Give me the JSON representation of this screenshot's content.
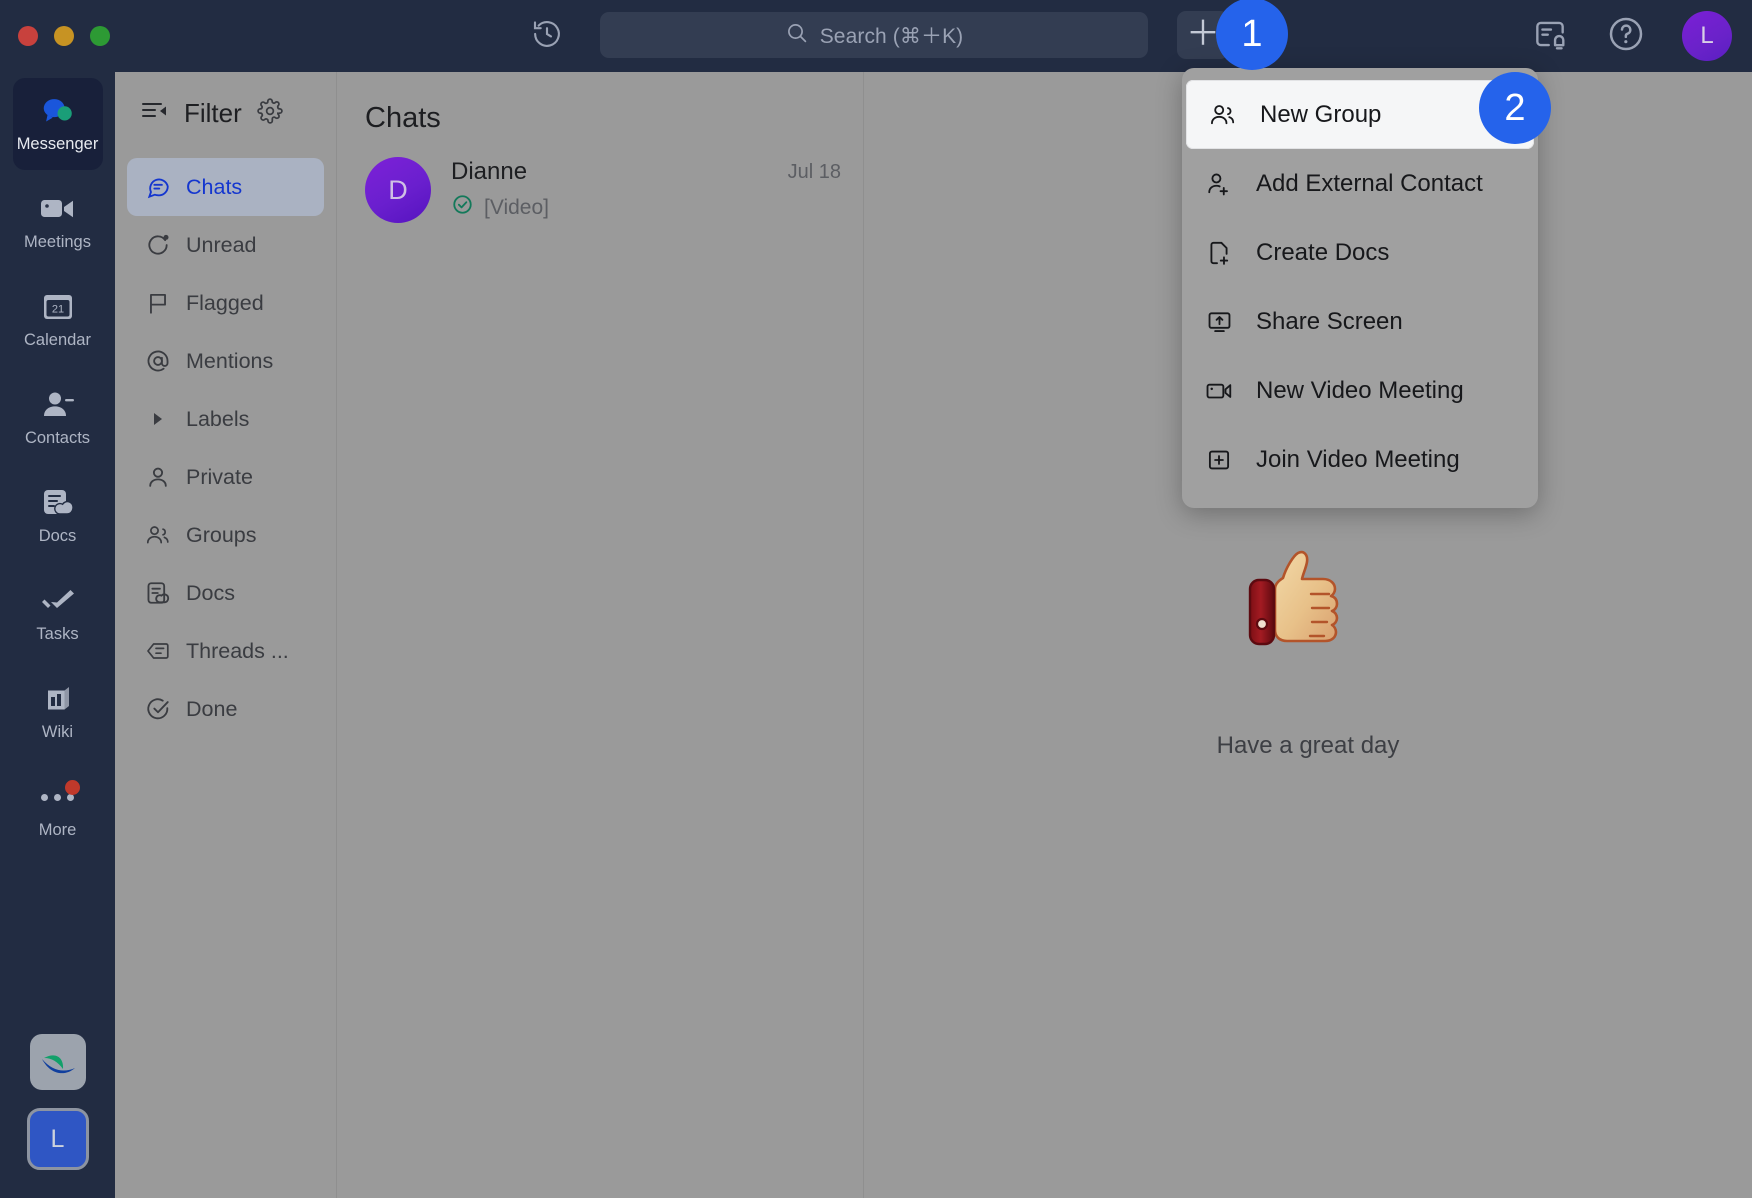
{
  "window": {
    "traffic_lights": [
      "close",
      "minimize",
      "zoom"
    ]
  },
  "topbar": {
    "history_icon": "history-clock-icon",
    "search": {
      "placeholder": "Search (⌘＋K)",
      "value": "",
      "icon": "search-icon"
    },
    "plus_label": "＋",
    "notifications_icon": "notifications-bell-icon",
    "help_icon": "help-circle-icon",
    "avatar_initial": "L"
  },
  "rail": {
    "items": [
      {
        "label": "Messenger",
        "icon": "messenger-bubbles-icon",
        "active": true
      },
      {
        "label": "Meetings",
        "icon": "video-camera-icon",
        "active": false
      },
      {
        "label": "Calendar",
        "icon": "calendar-21-icon",
        "active": false,
        "day": "21"
      },
      {
        "label": "Contacts",
        "icon": "contacts-person-icon",
        "active": false
      },
      {
        "label": "Docs",
        "icon": "docs-cloud-icon",
        "active": false
      },
      {
        "label": "Tasks",
        "icon": "tasks-check-icon",
        "active": false
      },
      {
        "label": "Wiki",
        "icon": "wiki-book-icon",
        "active": false
      },
      {
        "label": "More",
        "icon": "more-dots-icon",
        "active": false,
        "has_badge": true
      }
    ],
    "brand_icon": "app-brand-logo",
    "user_initial": "L"
  },
  "filter": {
    "title": "Filter",
    "settings_icon": "gear-icon",
    "items": [
      {
        "label": "Chats",
        "icon": "chat-bubble-icon",
        "active": true
      },
      {
        "label": "Unread",
        "icon": "unread-dot-icon",
        "active": false
      },
      {
        "label": "Flagged",
        "icon": "flag-icon",
        "active": false
      },
      {
        "label": "Mentions",
        "icon": "at-sign-icon",
        "active": false
      },
      {
        "label": "Labels",
        "icon": "chevron-right-icon",
        "active": false
      },
      {
        "label": "Private",
        "icon": "person-icon",
        "active": false
      },
      {
        "label": "Groups",
        "icon": "group-people-icon",
        "active": false
      },
      {
        "label": "Docs",
        "icon": "docs-cloud-icon",
        "active": false
      },
      {
        "label": "Threads ...",
        "icon": "threads-icon",
        "active": false
      },
      {
        "label": "Done",
        "icon": "done-check-icon",
        "active": false
      }
    ]
  },
  "chats": {
    "title": "Chats",
    "rows": [
      {
        "avatar_initial": "D",
        "name": "Dianne",
        "status_icon": "sent-check-icon",
        "preview": "[Video]",
        "date": "Jul 18"
      }
    ]
  },
  "main": {
    "empty_icon": "thumbs-up-emoji",
    "empty_message": "Have a great day"
  },
  "menu": {
    "items": [
      {
        "label": "New Group",
        "icon": "new-group-icon",
        "highlighted": true
      },
      {
        "label": "Add External Contact",
        "icon": "add-person-icon",
        "highlighted": false
      },
      {
        "label": "Create Docs",
        "icon": "create-doc-icon",
        "highlighted": false
      },
      {
        "label": "Share Screen",
        "icon": "share-screen-icon",
        "highlighted": false
      },
      {
        "label": "New Video Meeting",
        "icon": "video-camera-icon",
        "highlighted": false
      },
      {
        "label": "Join Video Meeting",
        "icon": "join-plus-box-icon",
        "highlighted": false
      }
    ]
  },
  "annotations": {
    "step1": "1",
    "step2": "2",
    "accent": "#2563eb"
  }
}
